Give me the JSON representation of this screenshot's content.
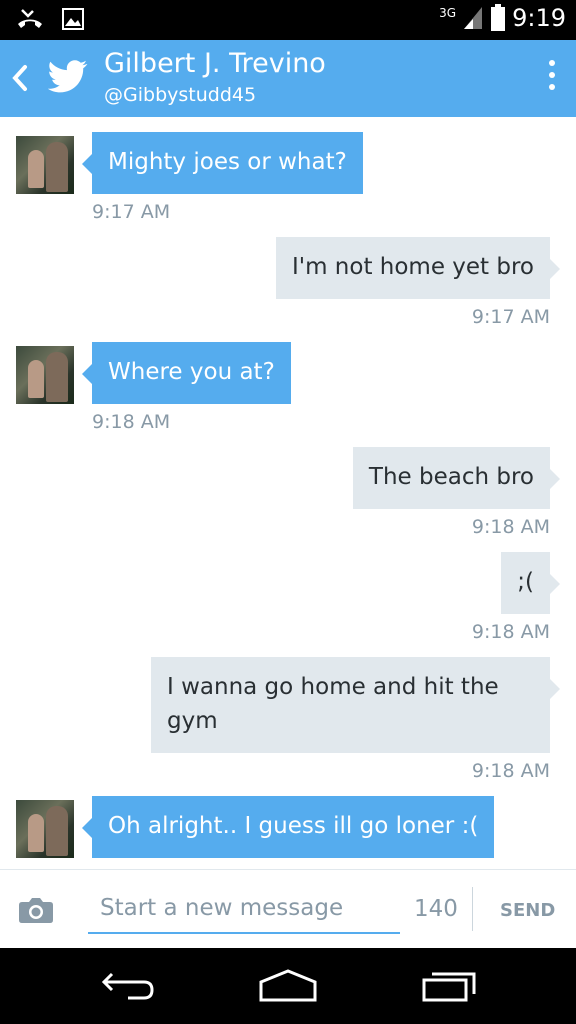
{
  "status_bar": {
    "network": "3G",
    "time": "9:19",
    "icons": [
      "missed-call-icon",
      "image-notification-icon",
      "signal-icon",
      "battery-icon"
    ]
  },
  "header": {
    "title": "Gilbert J. Trevino",
    "handle": "@Gibbystudd45",
    "icons": [
      "back-icon",
      "twitter-bird-icon",
      "overflow-menu-icon"
    ]
  },
  "messages": [
    {
      "direction": "in",
      "text": "Mighty joes or what?",
      "time": "9:17 AM"
    },
    {
      "direction": "out",
      "text": "I'm not home yet bro",
      "time": "9:17 AM"
    },
    {
      "direction": "in",
      "text": "Where you at?",
      "time": "9:18 AM"
    },
    {
      "direction": "out",
      "text": "The beach bro",
      "time": "9:18 AM"
    },
    {
      "direction": "out",
      "text": ";(",
      "time": "9:18 AM"
    },
    {
      "direction": "out",
      "text": "I wanna go home and hit the gym",
      "time": "9:18 AM"
    },
    {
      "direction": "in",
      "text": "Oh alright.. I guess ill go loner :(",
      "time": ""
    }
  ],
  "composer": {
    "placeholder": "Start a new message",
    "value": "",
    "char_count": "140",
    "send_label": "SEND"
  },
  "colors": {
    "accent": "#55acee",
    "outgoing_bubble": "#e1e8ed",
    "timestamp": "#8899a6"
  }
}
